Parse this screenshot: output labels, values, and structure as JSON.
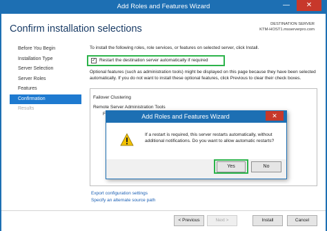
{
  "window": {
    "title": "Add Roles and Features Wizard",
    "close_glyph": "✕",
    "minimize_glyph": "—"
  },
  "header": {
    "heading": "Confirm installation selections",
    "destination_label": "DESTINATION SERVER",
    "destination_server": "KTM-HOST1.msserverpro.com"
  },
  "nav": {
    "items": [
      {
        "label": "Before You Begin",
        "state": "normal"
      },
      {
        "label": "Installation Type",
        "state": "normal"
      },
      {
        "label": "Server Selection",
        "state": "normal"
      },
      {
        "label": "Server Roles",
        "state": "normal"
      },
      {
        "label": "Features",
        "state": "normal"
      },
      {
        "label": "Confirmation",
        "state": "active"
      },
      {
        "label": "Results",
        "state": "disabled"
      }
    ]
  },
  "main": {
    "intro": "To install the following roles, role services, or features on selected server, click Install.",
    "restart_checkbox": {
      "checked": true,
      "label": "Restart the destination server automatically if required"
    },
    "optional_text": "Optional features (such as administration tools) might be displayed on this page because they have been selected automatically. If you do not want to install these optional features, click Previous to clear their check boxes.",
    "features": [
      "Failover Clustering",
      "Remote Server Administration Tools",
      "F"
    ],
    "links": {
      "export": "Export configuration settings",
      "alternate_source": "Specify an alternate source path"
    }
  },
  "footer": {
    "previous": "< Previous",
    "next": "Next >",
    "install": "Install",
    "cancel": "Cancel"
  },
  "dialog": {
    "title": "Add Roles and Features Wizard",
    "close_glyph": "✕",
    "icon": "warning-icon",
    "message": "If a restart is required, this server restarts automatically, without additional notifications. Do you want to allow automatic restarts?",
    "yes": "Yes",
    "no": "No"
  },
  "colors": {
    "titlebar": "#1d6fb3",
    "close": "#c7382b",
    "nav_active": "#1e7ad0",
    "highlight": "#2bb34a",
    "link": "#1a5fb4"
  }
}
